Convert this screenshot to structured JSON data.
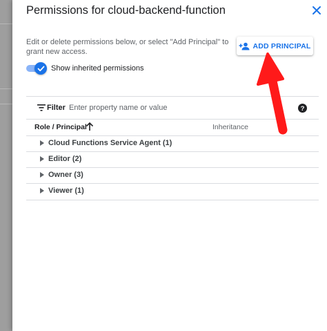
{
  "dialog": {
    "title": "Permissions for cloud-backend-function",
    "description": "Edit or delete permissions below, or select \"Add Principal\" to grant new access.",
    "add_button": {
      "label": "ADD PRINCIPAL",
      "icon": "person-add-icon"
    },
    "show_inherited": {
      "label": "Show inherited permissions",
      "checked": true
    }
  },
  "filter": {
    "label": "Filter",
    "placeholder": "Enter property name or value",
    "value": ""
  },
  "table": {
    "columns": {
      "role": "Role / Principal",
      "inheritance": "Inheritance"
    },
    "rows": [
      {
        "label": "Cloud Functions Service Agent (1)"
      },
      {
        "label": "Editor (2)"
      },
      {
        "label": "Owner (3)"
      },
      {
        "label": "Viewer (1)"
      }
    ]
  },
  "colors": {
    "accent": "#1a73e8",
    "annotation_arrow": "#ff1a1a",
    "backdrop": "#9e9e9e"
  }
}
